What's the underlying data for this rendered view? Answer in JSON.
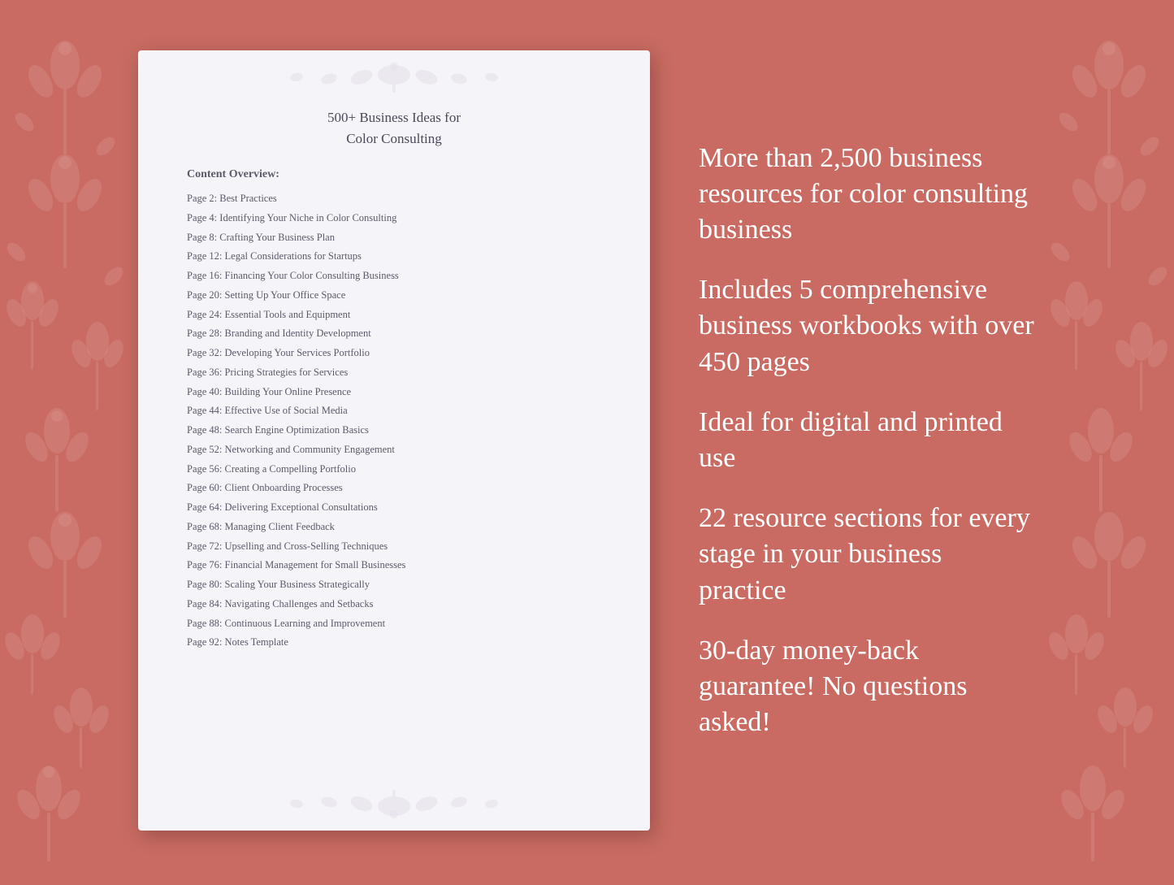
{
  "background_color": "#c96b62",
  "document": {
    "title_line1": "500+ Business Ideas for",
    "title_line2": "Color Consulting",
    "section_label": "Content Overview:",
    "toc_items": [
      {
        "page": "Page  2:",
        "title": "Best Practices"
      },
      {
        "page": "Page  4:",
        "title": "Identifying Your Niche in Color Consulting"
      },
      {
        "page": "Page  8:",
        "title": "Crafting Your Business Plan"
      },
      {
        "page": "Page 12:",
        "title": "Legal Considerations for Startups"
      },
      {
        "page": "Page 16:",
        "title": "Financing Your Color Consulting Business"
      },
      {
        "page": "Page 20:",
        "title": "Setting Up Your Office Space"
      },
      {
        "page": "Page 24:",
        "title": "Essential Tools and Equipment"
      },
      {
        "page": "Page 28:",
        "title": "Branding and Identity Development"
      },
      {
        "page": "Page 32:",
        "title": "Developing Your Services Portfolio"
      },
      {
        "page": "Page 36:",
        "title": "Pricing Strategies for Services"
      },
      {
        "page": "Page 40:",
        "title": "Building Your Online Presence"
      },
      {
        "page": "Page 44:",
        "title": "Effective Use of Social Media"
      },
      {
        "page": "Page 48:",
        "title": "Search Engine Optimization Basics"
      },
      {
        "page": "Page 52:",
        "title": "Networking and Community Engagement"
      },
      {
        "page": "Page 56:",
        "title": "Creating a Compelling Portfolio"
      },
      {
        "page": "Page 60:",
        "title": "Client Onboarding Processes"
      },
      {
        "page": "Page 64:",
        "title": "Delivering Exceptional Consultations"
      },
      {
        "page": "Page 68:",
        "title": "Managing Client Feedback"
      },
      {
        "page": "Page 72:",
        "title": "Upselling and Cross-Selling Techniques"
      },
      {
        "page": "Page 76:",
        "title": "Financial Management for Small Businesses"
      },
      {
        "page": "Page 80:",
        "title": "Scaling Your Business Strategically"
      },
      {
        "page": "Page 84:",
        "title": "Navigating Challenges and Setbacks"
      },
      {
        "page": "Page 88:",
        "title": "Continuous Learning and Improvement"
      },
      {
        "page": "Page 92:",
        "title": "Notes Template"
      }
    ]
  },
  "features": [
    {
      "id": "feature1",
      "text": "More than 2,500 business resources for color consulting business"
    },
    {
      "id": "feature2",
      "text": "Includes 5 comprehensive business workbooks with over 450 pages"
    },
    {
      "id": "feature3",
      "text": "Ideal for digital and printed use"
    },
    {
      "id": "feature4",
      "text": "22 resource sections for every stage in your business practice"
    },
    {
      "id": "feature5",
      "text": "30-day money-back guarantee! No questions asked!"
    }
  ]
}
